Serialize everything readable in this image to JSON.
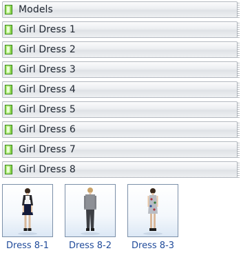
{
  "categories": [
    {
      "label": "Models"
    },
    {
      "label": "Girl Dress 1"
    },
    {
      "label": "Girl Dress 2"
    },
    {
      "label": "Girl Dress 3"
    },
    {
      "label": "Girl Dress 4"
    },
    {
      "label": "Girl Dress 5"
    },
    {
      "label": "Girl Dress 6"
    },
    {
      "label": "Girl Dress 7"
    },
    {
      "label": "Girl Dress 8"
    }
  ],
  "thumbnails": [
    {
      "caption": "Dress 8-1",
      "icon": "model-figure-black-dress"
    },
    {
      "caption": "Dress 8-2",
      "icon": "model-figure-gray-outfit"
    },
    {
      "caption": "Dress 8-3",
      "icon": "model-figure-patterned-dress"
    }
  ],
  "colors": {
    "icon_green": "#7ccc3c",
    "caption_blue": "#1f4a9a",
    "thumb_border": "#7b8fa8"
  }
}
